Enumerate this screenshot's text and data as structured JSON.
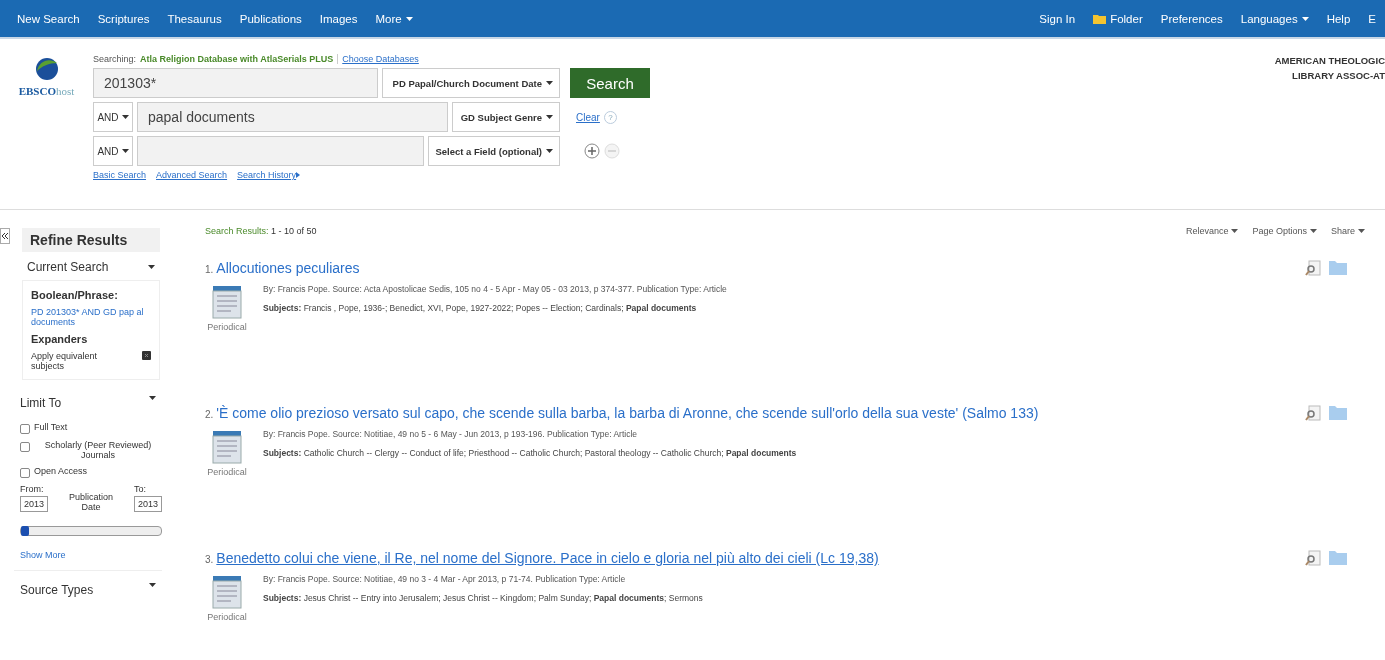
{
  "top_nav": {
    "left": [
      "New Search",
      "Scriptures",
      "Thesaurus",
      "Publications",
      "Images",
      "More"
    ],
    "right": [
      {
        "label": "Sign In",
        "kind": "link"
      },
      {
        "label": "Folder",
        "kind": "folder"
      },
      {
        "label": "Preferences",
        "kind": "link"
      },
      {
        "label": "Languages",
        "kind": "menu"
      },
      {
        "label": "Help",
        "kind": "link"
      },
      {
        "label": "E",
        "kind": "link"
      }
    ]
  },
  "logo": {
    "text_main": "EBSCO",
    "text_sub": "host"
  },
  "searching": {
    "label": "Searching:",
    "database": "Atla Religion Database with AtlaSerials PLUS",
    "link": "Choose Databases"
  },
  "search_rows": [
    {
      "operator": null,
      "value": "201303*",
      "field": "PD Papal/Church Document Date"
    },
    {
      "operator": "AND",
      "value": "papal documents",
      "field": "GD Subject Genre"
    },
    {
      "operator": "AND",
      "value": null,
      "field": "Select a Field (optional)"
    }
  ],
  "search_button": "Search",
  "clear_link": "Clear",
  "help_mark": "?",
  "search_links": [
    "Basic Search",
    "Advanced Search",
    "Search History"
  ],
  "institution": [
    "AMERICAN THEOLOGIC",
    "LIBRARY ASSOC-AT"
  ],
  "sidebar": {
    "title": "Refine Results",
    "current_search": {
      "title": "Current Search",
      "boolean_label": "Boolean/Phrase:",
      "boolean_value": "PD 201303* AND GD pap al documents",
      "expanders_label": "Expanders",
      "expander": "Apply equivalent subjects"
    },
    "limit_to": {
      "title": "Limit To",
      "options": [
        {
          "label": "Full Text",
          "checked": false
        },
        {
          "label": "Scholarly (Peer Reviewed) Journals",
          "checked": false
        },
        {
          "label": "Open Access",
          "checked": false
        }
      ],
      "from_label": "From:",
      "to_label": "To:",
      "from": "2013",
      "to": "2013",
      "date_label": "Publication Date",
      "level": 0,
      "show_more": "Show More"
    },
    "source_types": "Source Types"
  },
  "results_header": {
    "label": "Search Results:",
    "range": "1 - 10 of 50",
    "tools": [
      "Relevance",
      "Page Options",
      "Share"
    ]
  },
  "results": [
    {
      "number": "1.",
      "title": "Allocutiones peculiares",
      "hovered": false,
      "type": "Periodical",
      "meta": "By: Francis Pope. Source: Acta Apostolicae Sedis, 105 no 4 - 5 Apr - May 05 - 03 2013, p 374-377. Publication Type: Article",
      "subjects": "**Subjects:** Francis , Pope, 1936-; Benedict, XVI, Pope, 1927-2022; Popes -- Election; Cardinals; **Papal documents**"
    },
    {
      "number": "2.",
      "title": "'È come olio prezioso versato sul capo, che scende sulla barba, la barba di Aronne, che scende sull'orlo della sua veste' (Salmo 133)",
      "hovered": false,
      "type": "Periodical",
      "meta": "By: Francis Pope. Source: Notitiae, 49 no 5 - 6 May - Jun 2013, p 193-196. Publication Type: Article",
      "subjects": "**Subjects:** Catholic Church -- Clergy -- Conduct of life; Priesthood -- Catholic Church; Pastoral theology -- Catholic Church; **Papal documents**"
    },
    {
      "number": "3.",
      "title": "Benedetto colui che viene, il Re, nel nome del Signore. Pace in cielo e gloria nel più alto dei cieli (Lc 19,38)",
      "hovered": true,
      "type": "Periodical",
      "meta": "By: Francis Pope. Source: Notitiae, 49 no 3 - 4 Mar - Apr 2013, p 71-74. Publication Type: Article",
      "subjects": "**Subjects:** Jesus Christ -- Entry into Jerusalem; Jesus Christ -- Kingdom; Palm Sunday; **Papal documents**; Sermons"
    }
  ]
}
